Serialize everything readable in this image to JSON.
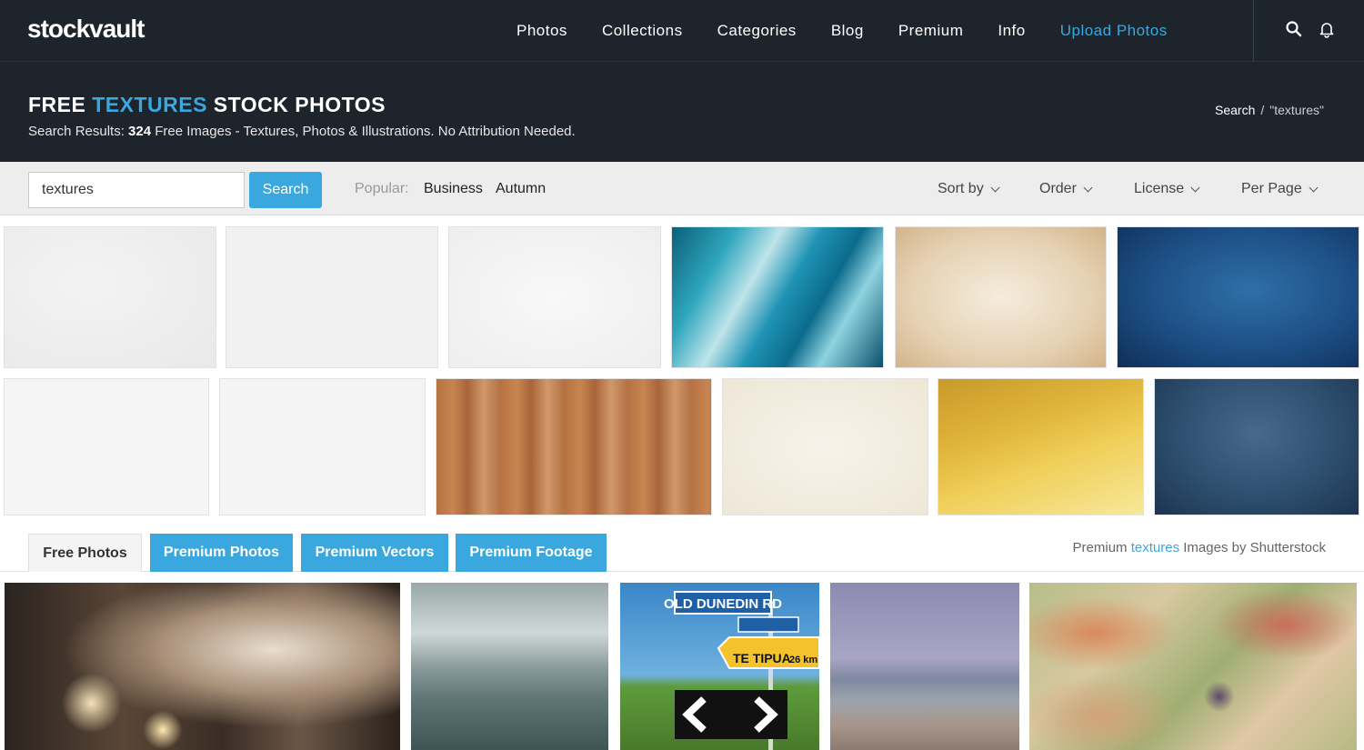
{
  "nav": {
    "logo": "stockvault",
    "links": [
      "Photos",
      "Collections",
      "Categories",
      "Blog",
      "Premium",
      "Info"
    ],
    "upload": "Upload Photos",
    "icons": [
      "search-icon",
      "bell-icon"
    ]
  },
  "hero": {
    "title_pre": "FREE ",
    "title_hl": "TEXTURES",
    "title_post": " STOCK PHOTOS",
    "sub_pre": "Search Results: ",
    "sub_count": "324",
    "sub_post": " Free Images - Textures, Photos & Illustrations. No Attribution Needed.",
    "crumb_search": "Search",
    "crumb_sep": "/",
    "crumb_term": "\"textures\""
  },
  "search": {
    "value": "textures",
    "button": "Search",
    "popular_label": "Popular:",
    "tags": [
      "Business",
      "Autumn"
    ],
    "dropdowns": [
      "Sort by",
      "Order",
      "License",
      "Per Page"
    ]
  },
  "tabs": {
    "free": "Free Photos",
    "premium_photos": "Premium Photos",
    "premium_vectors": "Premium Vectors",
    "premium_footage": "Premium Footage"
  },
  "shutterstock": {
    "pre": "Premium ",
    "term": "textures",
    "post": " Images by Shutterstock"
  },
  "sign": {
    "line1": "OLD DUNEDIN RD",
    "line2": "TE TIPUA",
    "dist": "26 km"
  },
  "colors": {
    "accent": "#3aa8de",
    "nav_bg": "#1e242c"
  }
}
